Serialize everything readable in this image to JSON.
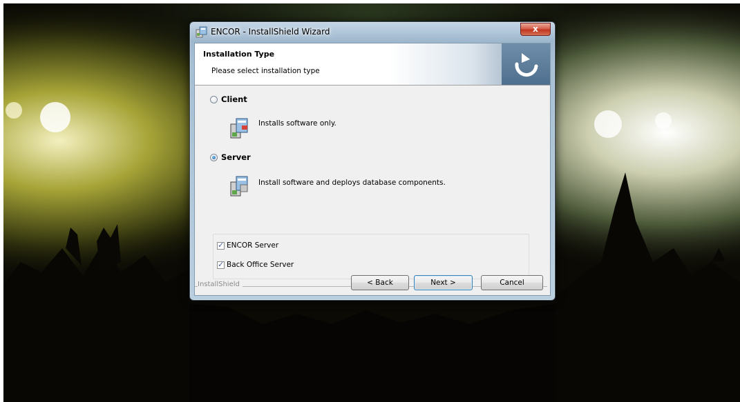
{
  "window": {
    "title": "ENCOR - InstallShield Wizard",
    "close_glyph": "x"
  },
  "banner": {
    "title": "Installation Type",
    "subtitle": "Please select installation type",
    "logo_icon": "installshield-arrow-icon"
  },
  "options": {
    "client": {
      "label": "Client",
      "description": "Installs software only.",
      "selected": false
    },
    "server": {
      "label": "Server",
      "description": "Install software and deploys database components.",
      "selected": true
    }
  },
  "components": [
    {
      "label": "ENCOR Server",
      "checked": true
    },
    {
      "label": "Back Office Server",
      "checked": true
    }
  ],
  "footer": {
    "brand": "InstallShield",
    "back_label": "< Back",
    "next_label": "Next >",
    "cancel_label": "Cancel"
  },
  "colors": {
    "titlebar": "#a7bfd3",
    "close_button": "#c0361f",
    "dialog_bg": "#f0f0f0",
    "radio_selected": "#1d5d9f"
  }
}
